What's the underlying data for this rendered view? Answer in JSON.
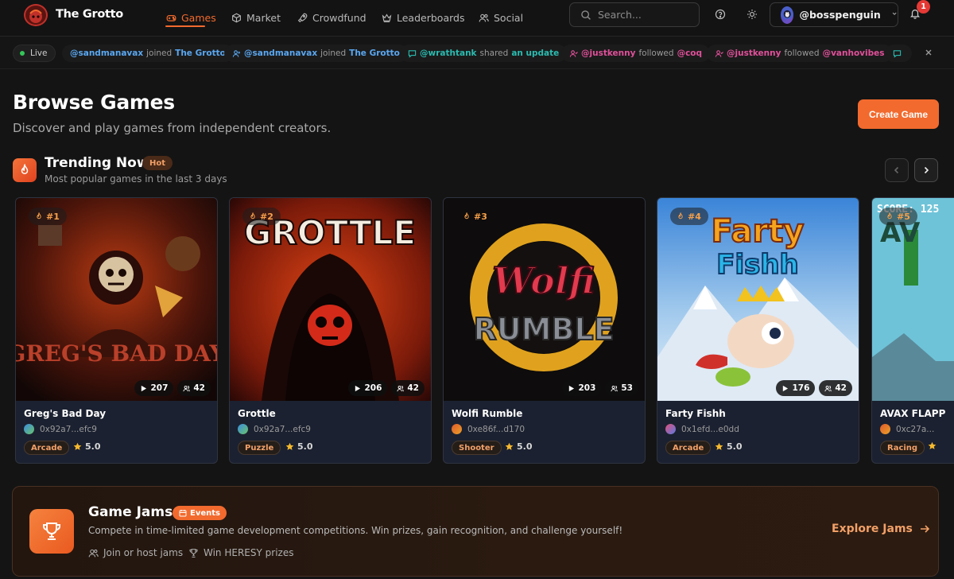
{
  "app": {
    "brand": "The Grotto"
  },
  "nav": [
    {
      "label": "Games",
      "icon": "gamepad-icon",
      "active": true
    },
    {
      "label": "Market",
      "icon": "cube-icon"
    },
    {
      "label": "Crowdfund",
      "icon": "rocket-icon"
    },
    {
      "label": "Leaderboards",
      "icon": "crown-icon"
    },
    {
      "label": "Social",
      "icon": "users-icon"
    }
  ],
  "search": {
    "placeholder": "Search..."
  },
  "user": {
    "handle": "@bosspenguin",
    "notifications": "1"
  },
  "ticker": {
    "live_label": "Live",
    "items": [
      {
        "user": "@sandmanavax",
        "action": "joined",
        "target": "The Grotto",
        "color": "#5aa7f0",
        "icon": "user-plus-icon"
      },
      {
        "user": "@sandmanavax",
        "action": "joined",
        "target": "The Grotto",
        "color": "#5aa7f0",
        "icon": "user-plus-icon"
      },
      {
        "user": "@wrathtank",
        "action": "shared",
        "target": "an update",
        "color": "#2bbbb0",
        "icon": "message-icon"
      },
      {
        "user": "@justkenny",
        "action": "followed",
        "target": "@coq",
        "color": "#e0509a",
        "icon": "user-follow-icon"
      },
      {
        "user": "@justkenny",
        "action": "followed",
        "target": "@vanhovibes",
        "color": "#e0509a",
        "icon": "user-follow-icon"
      }
    ]
  },
  "page": {
    "title": "Browse Games",
    "subtitle": "Discover and play games from independent creators.",
    "create_label": "Create Game"
  },
  "trending": {
    "title": "Trending Now",
    "badge": "Hot",
    "subtitle": "Most popular games in the last 3 days"
  },
  "games": [
    {
      "rank": "#1",
      "name": "Greg's Bad Day",
      "author": "0x92a7...efc9",
      "tag": "Arcade",
      "rating": "5.0",
      "plays": "207",
      "players": "42",
      "art_text": "GREG'S BAD DAY"
    },
    {
      "rank": "#2",
      "name": "Grottle",
      "author": "0x92a7...efc9",
      "tag": "Puzzle",
      "rating": "5.0",
      "plays": "206",
      "players": "42",
      "art_text": "GROTTLE"
    },
    {
      "rank": "#3",
      "name": "Wolfi Rumble",
      "author": "0xe86f...d170",
      "tag": "Shooter",
      "rating": "5.0",
      "plays": "203",
      "players": "53",
      "art_text": "Wolfi RUMBLE"
    },
    {
      "rank": "#4",
      "name": "Farty Fishh",
      "author": "0x1efd...e0dd",
      "tag": "Arcade",
      "rating": "5.0",
      "plays": "176",
      "players": "42",
      "art_text": "Farty Fishh"
    },
    {
      "rank": "#5",
      "name": "AVAX FLAPP",
      "author": "0xc27a...",
      "tag": "Racing",
      "rating": "",
      "plays": "",
      "players": "",
      "art_text": "SCORE: 125"
    }
  ],
  "jams": {
    "title": "Game Jams",
    "badge": "Events",
    "description": "Compete in time-limited game development competitions. Win prizes, gain recognition, and challenge yourself!",
    "features": [
      "Join or host jams",
      "Win HERESY prizes"
    ],
    "cta": "Explore Jams"
  }
}
